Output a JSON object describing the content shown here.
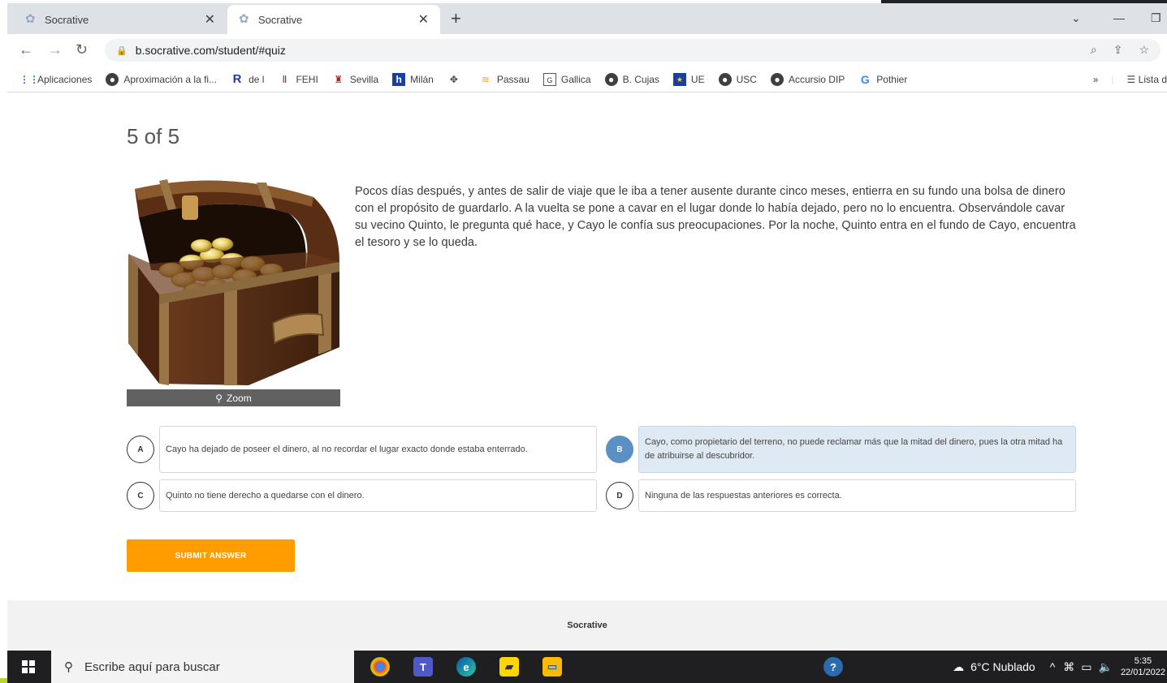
{
  "browser": {
    "tabs": [
      {
        "title": "Socrative",
        "active": false
      },
      {
        "title": "Socrative",
        "active": true
      }
    ],
    "url": "b.socrative.com/student/#quiz",
    "bookmarks": [
      "Aplicaciones",
      "Aproximación a la fi...",
      "de l",
      "FEHI",
      "Sevilla",
      "Milán",
      "",
      "Passau",
      "Gallica",
      "B. Cujas",
      "UE",
      "USC",
      "Accursio DIP",
      "Pothier"
    ],
    "bookmarks_more": "»",
    "reading_list": "Lista d"
  },
  "quiz": {
    "progress": "5 of 5",
    "zoom_label": "Zoom",
    "question": "Pocos días después, y antes de salir de viaje que le iba a tener ausente durante cinco meses, entierra en su fundo una bolsa de dinero con el propósito de guardarlo. A la vuelta se pone a cavar en el lugar donde lo había dejado, pero no lo encuentra. Observándole cavar su vecino Quinto, le pregunta qué hace, y Cayo le confía sus preocupaciones. Por la noche, Quinto entra en el fundo de Cayo, encuentra el tesoro y se lo queda.",
    "answers": [
      {
        "letter": "A",
        "text": "Cayo ha dejado de poseer el dinero, al no recordar el lugar exacto donde estaba enterrado.",
        "selected": false
      },
      {
        "letter": "B",
        "text": "Cayo, como propietario del terreno, no puede reclamar más que la mitad del dinero, pues la otra mitad ha de atribuirse al descubridor.",
        "selected": true
      },
      {
        "letter": "C",
        "text": "Quinto no tiene derecho a quedarse con el dinero.",
        "selected": false
      },
      {
        "letter": "D",
        "text": "Ninguna de las respuestas anteriores es correcta.",
        "selected": false
      }
    ],
    "submit_label": "SUBMIT ANSWER",
    "footer": "Socrative"
  },
  "taskbar": {
    "search_placeholder": "Escribe aquí para buscar",
    "weather": "6°C  Nublado",
    "time": "5:35",
    "date": "22/01/2022"
  },
  "colors": {
    "accent_orange": "#ff9d00",
    "selected_blue": "#5b90c4",
    "selected_bg": "#dfe9f3"
  }
}
